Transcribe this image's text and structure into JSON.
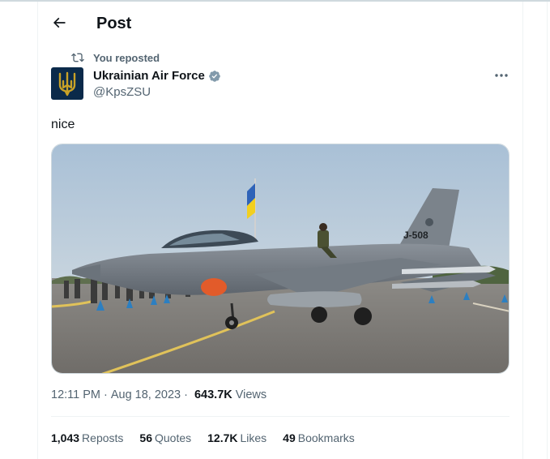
{
  "header": {
    "title": "Post",
    "back_icon": "arrow-left-icon"
  },
  "repost": {
    "label": "You reposted",
    "icon": "repost-icon"
  },
  "author": {
    "display_name": "Ukrainian Air Force",
    "handle": "@KpsZSU",
    "verified": true,
    "avatar_icon": "trident-icon",
    "avatar_bg": "#0b2a4a",
    "avatar_accent": "#c9a227"
  },
  "tweet": {
    "text": "nice",
    "image_label": "J-508"
  },
  "meta": {
    "time": "12:11 PM",
    "separator": "·",
    "date": "Aug 18, 2023",
    "views_count": "643.7K",
    "views_label": "Views"
  },
  "stats": [
    {
      "num": "1,043",
      "label": "Reposts"
    },
    {
      "num": "56",
      "label": "Quotes"
    },
    {
      "num": "12.7K",
      "label": "Likes"
    },
    {
      "num": "49",
      "label": "Bookmarks"
    }
  ],
  "colors": {
    "text": "#0f1419",
    "secondary": "#536471",
    "verified": "#829aab",
    "border": "#eff3f4"
  }
}
